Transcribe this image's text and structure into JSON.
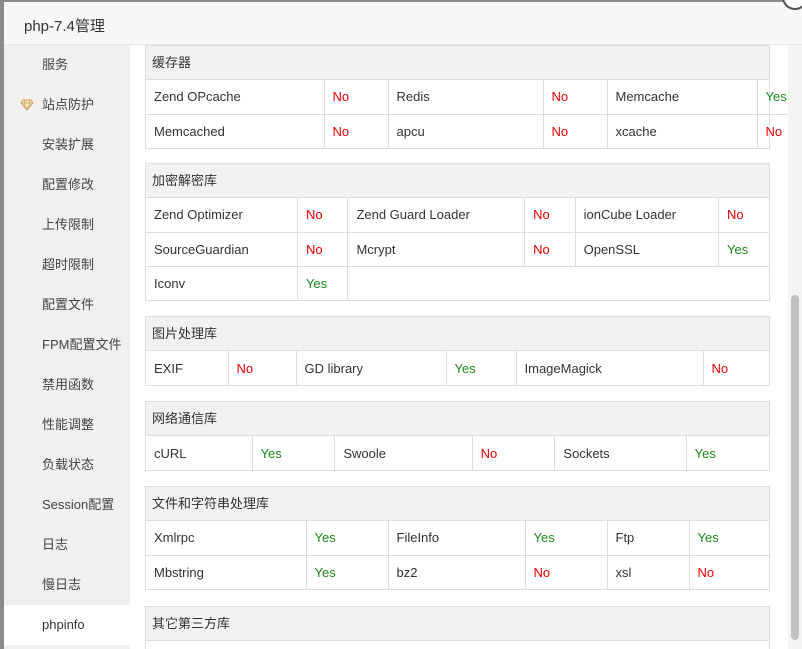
{
  "window": {
    "title": "php-7.4管理",
    "close_glyph": "✕"
  },
  "sidebar": {
    "items": [
      {
        "label": "服务"
      },
      {
        "label": "站点防护",
        "icon": "gem-icon"
      },
      {
        "label": "安装扩展"
      },
      {
        "label": "配置修改"
      },
      {
        "label": "上传限制"
      },
      {
        "label": "超时限制"
      },
      {
        "label": "配置文件"
      },
      {
        "label": "FPM配置文件"
      },
      {
        "label": "禁用函数"
      },
      {
        "label": "性能调整"
      },
      {
        "label": "负载状态"
      },
      {
        "label": "Session配置"
      },
      {
        "label": "日志"
      },
      {
        "label": "慢日志"
      },
      {
        "label": "phpinfo",
        "active": true
      }
    ]
  },
  "sections": [
    {
      "title": "缓存器",
      "rows": [
        [
          [
            "Zend OPcache",
            "No"
          ],
          [
            "Redis",
            "No"
          ],
          [
            "Memcache",
            "Yes"
          ]
        ],
        [
          [
            "Memcached",
            "No"
          ],
          [
            "apcu",
            "No"
          ],
          [
            "xcache",
            "No"
          ]
        ]
      ]
    },
    {
      "title": "加密解密库",
      "rows": [
        [
          [
            "Zend Optimizer",
            "No"
          ],
          [
            "Zend Guard Loader",
            "No"
          ],
          [
            "ionCube Loader",
            "No"
          ]
        ],
        [
          [
            "SourceGuardian",
            "No"
          ],
          [
            "Mcrypt",
            "No"
          ],
          [
            "OpenSSL",
            "Yes"
          ]
        ],
        [
          [
            "Iconv",
            "Yes"
          ]
        ]
      ]
    },
    {
      "title": "图片处理库",
      "rows": [
        [
          [
            "EXIF",
            "No"
          ],
          [
            "GD library",
            "Yes"
          ],
          [
            "ImageMagick",
            "No"
          ]
        ]
      ]
    },
    {
      "title": "网络通信库",
      "rows": [
        [
          [
            "cURL",
            "Yes"
          ],
          [
            "Swoole",
            "No"
          ],
          [
            "Sockets",
            "Yes"
          ]
        ]
      ]
    },
    {
      "title": "文件和字符串处理库",
      "rows": [
        [
          [
            "Xmlrpc",
            "Yes"
          ],
          [
            "FileInfo",
            "Yes"
          ],
          [
            "Ftp",
            "Yes"
          ]
        ],
        [
          [
            "Mbstring",
            "Yes"
          ],
          [
            "bz2",
            "No"
          ],
          [
            "xsl",
            "No"
          ]
        ]
      ]
    },
    {
      "title": "其它第三方库",
      "rows": []
    }
  ],
  "colors": {
    "no": "#e00000",
    "yes": "#1a8a1a"
  }
}
